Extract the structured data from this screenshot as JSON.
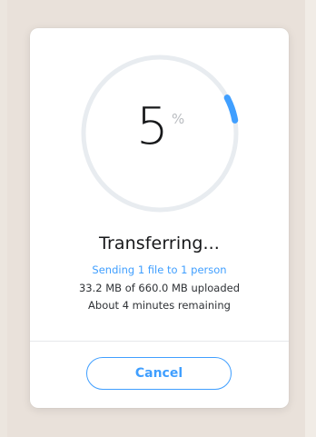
{
  "transfer": {
    "percent_value": "5",
    "percent_sign": "%",
    "progress": 0.05,
    "title": "Transferring...",
    "subtitle": "Sending 1 file to 1 person",
    "uploaded": "33.2 MB of 660.0 MB uploaded",
    "remaining": "About 4 minutes remaining",
    "cancel_label": "Cancel"
  },
  "colors": {
    "accent": "#409fff",
    "track": "#e8ecf0",
    "text": "#17181a",
    "muted": "#b9bcc0",
    "background": "#e9e1da"
  }
}
